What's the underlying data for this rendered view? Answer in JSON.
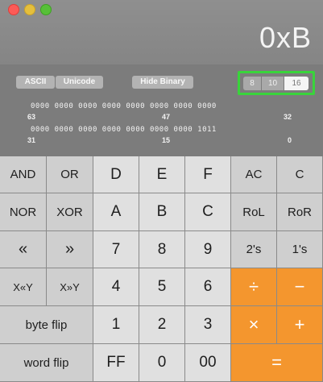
{
  "display": {
    "value": "0xB"
  },
  "modes": {
    "ascii": "ASCII",
    "unicode": "Unicode",
    "hide_binary": "Hide Binary"
  },
  "bases": {
    "oct": "8",
    "dec": "10",
    "hex": "16",
    "selected": "16"
  },
  "binary": {
    "row1": "0000 0000 0000 0000 0000 0000 0000 0000",
    "row1_labels": [
      "63",
      "47",
      "32"
    ],
    "row2": "0000 0000 0000 0000 0000 0000 0000 1011",
    "row2_labels": [
      "31",
      "15",
      "0"
    ]
  },
  "keys": {
    "and": "AND",
    "or": "OR",
    "d": "D",
    "e": "E",
    "f": "F",
    "ac": "AC",
    "c": "C",
    "nor": "NOR",
    "xor": "XOR",
    "a": "A",
    "b": "B",
    "c_hex": "C",
    "rol": "RoL",
    "ror": "RoR",
    "shift_left": "«",
    "shift_right": "»",
    "seven": "7",
    "eight": "8",
    "nine": "9",
    "twos": "2's",
    "ones": "1's",
    "x_shl_y": "X«Y",
    "x_shr_y": "X»Y",
    "four": "4",
    "five": "5",
    "six": "6",
    "divide": "÷",
    "minus": "−",
    "byte_flip": "byte flip",
    "one": "1",
    "two": "2",
    "three": "3",
    "multiply": "×",
    "plus": "+",
    "word_flip": "word flip",
    "ff": "FF",
    "zero": "0",
    "double_zero": "00",
    "equals": "="
  },
  "colors": {
    "accent_orange": "#f4962e",
    "highlight_green": "#39d43b"
  }
}
